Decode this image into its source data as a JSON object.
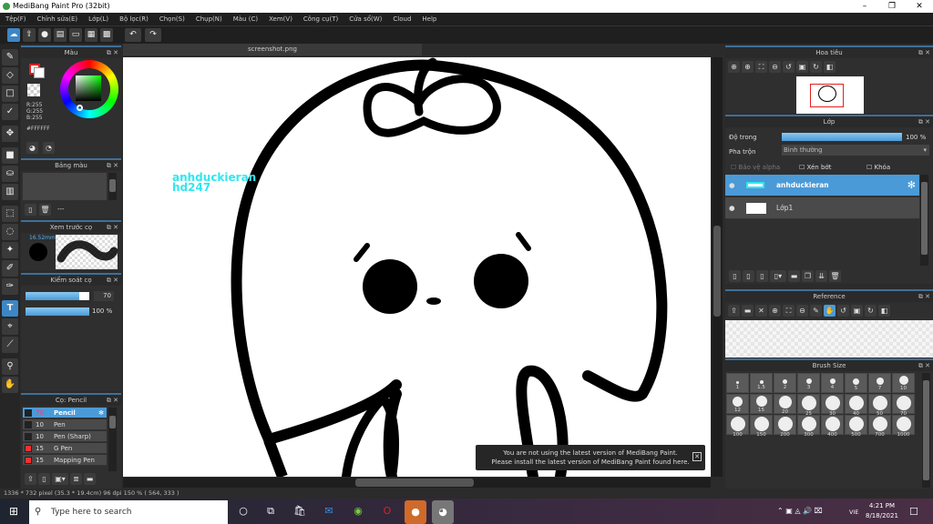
{
  "window": {
    "title": "MediBang Paint Pro (32bit)",
    "minimize": "–",
    "maximize": "❐",
    "close": "✕"
  },
  "menu": [
    "Tệp(F)",
    "Chỉnh sửa(E)",
    "Lớp(L)",
    "Bộ lọc(R)",
    "Chọn(S)",
    "Chụp(N)",
    "Màu (C)",
    "Xem(V)",
    "Công cụ(T)",
    "Cửa sổ(W)",
    "Cloud",
    "Help"
  ],
  "document": {
    "tab": "screenshot.png",
    "overlay_text_line1": "anhduckieran",
    "overlay_text_line2": "hd247",
    "overlay_text_color": "#2ee8f0"
  },
  "color_panel": {
    "title": "Màu",
    "r": "R:255",
    "g": "G:255",
    "b": "B:255",
    "hex": "#FFFFFF",
    "primary_color": "#FFFFFF",
    "accent_border": "#e02020"
  },
  "palette_panel": {
    "title": "Bảng màu",
    "dash": "---"
  },
  "brush_preview": {
    "title": "Xem trước cọ",
    "size": "16.52mm"
  },
  "brush_control": {
    "title": "Kiểm soát cọ",
    "size_value": "70",
    "size_fraction": 0.84,
    "opacity_value": "100 %",
    "opacity_fraction": 1.0
  },
  "brush_list": {
    "title": "Cọ: Pencil",
    "items": [
      {
        "size": "70",
        "name": "Pencil",
        "color": "#222222",
        "selected": true
      },
      {
        "size": "10",
        "name": "Pen",
        "color": "#222222"
      },
      {
        "size": "10",
        "name": "Pen (Sharp)",
        "color": "#222222"
      },
      {
        "size": "15",
        "name": "G Pen",
        "color": "#f03030"
      },
      {
        "size": "15",
        "name": "Mapping Pen",
        "color": "#f03030"
      }
    ]
  },
  "navigator": {
    "title": "Hoa tiêu"
  },
  "layer_panel": {
    "title": "Lớp",
    "opacity_label": "Độ trong",
    "opacity_value": "100 %",
    "opacity_fraction": 1.0,
    "blend_label": "Pha trộn",
    "blend_value": "Bình thường",
    "protect_alpha": "Bảo vệ alpha",
    "clipping": "Xén bớt",
    "lock": "Khóa",
    "layers": [
      {
        "name": "anhduckieran",
        "selected": true
      },
      {
        "name": "Lớp1",
        "selected": false
      }
    ]
  },
  "reference_panel": {
    "title": "Reference"
  },
  "brush_size_panel": {
    "title": "Brush Size",
    "sizes": [
      "1",
      "1.5",
      "2",
      "3",
      "4",
      "5",
      "7",
      "10",
      "12",
      "15",
      "20",
      "25",
      "30",
      "40",
      "50",
      "70",
      "100",
      "150",
      "200",
      "300",
      "400",
      "500",
      "700",
      "1000"
    ]
  },
  "notification": {
    "line1": "You are not using the latest version of MediBang Paint.",
    "line2": "Please install the latest version of MediBang Paint found here."
  },
  "status": {
    "text": "1336 * 732 pixel  (35.3 * 19.4cm)  96 dpi  150 %  ( 564, 333 )"
  },
  "taskbar": {
    "search_placeholder": "Type here to search",
    "time": "4:21 PM",
    "date": "8/18/2021",
    "lang": "VIE"
  }
}
